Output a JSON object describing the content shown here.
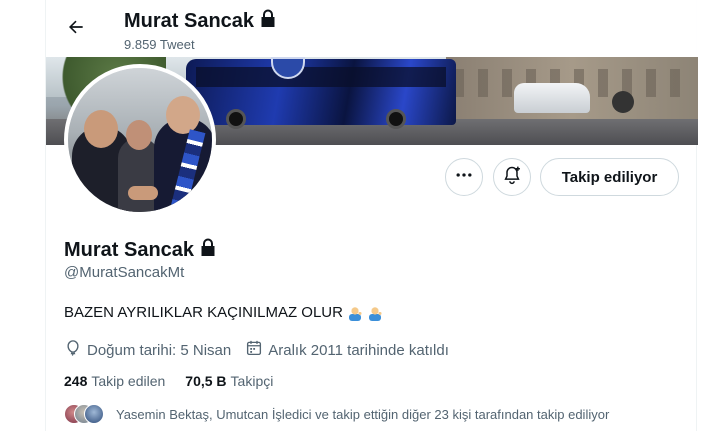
{
  "header": {
    "title": "Murat Sancak",
    "tweet_count": "9.859 Tweet"
  },
  "actions": {
    "follow_label": "Takip ediliyor"
  },
  "profile": {
    "name": "Murat Sancak",
    "handle": "@MuratSancakMt",
    "bio": "BAZEN AYRILIKLAR KAÇINILMAZ OLUR",
    "birthday": "Doğum tarihi: 5 Nisan",
    "joined": "Aralık 2011 tarihinde katıldı"
  },
  "stats": {
    "following_count": "248",
    "following_label": "Takip edilen",
    "followers_count": "70,5 B",
    "followers_label": "Takipçi"
  },
  "followers_you_know": "Yasemin Bektaş, Umutcan İşledici ve takip ettiğin diğer 23 kişi tarafından takip ediliyor",
  "icons": {
    "back": "arrow-left-icon",
    "lock": "lock-icon",
    "more": "more-horizontal-icon",
    "notify": "bell-plus-icon",
    "birthday": "balloon-icon",
    "calendar": "calendar-icon",
    "emoji": "person-tipping-hand-emoji"
  },
  "colors": {
    "text_primary": "#0f1419",
    "text_secondary": "#536471",
    "border": "#cfd9de"
  }
}
